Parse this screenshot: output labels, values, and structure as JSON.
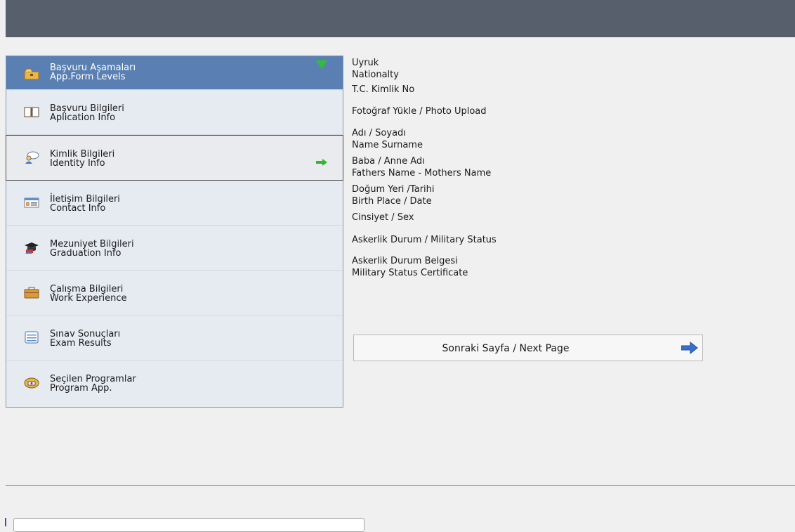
{
  "sidebar": {
    "header": {
      "line1": "Başvuru Aşamaları",
      "line2": "App.Form Levels",
      "icon": "folder-icon"
    },
    "items": [
      {
        "line1": "Başvuru Bilgileri",
        "line2": "Aplication Info",
        "icon": "book-icon"
      },
      {
        "line1": "Kimlik Bilgileri",
        "line2": "Identity Info",
        "icon": "user-icon",
        "active": true
      },
      {
        "line1": "İletişim Bilgileri",
        "line2": "Contact Info",
        "icon": "contact-card-icon"
      },
      {
        "line1": "Mezuniyet Bilgileri",
        "line2": "Graduation Info",
        "icon": "graduation-cap-icon"
      },
      {
        "line1": "Çalışma Bilgileri",
        "line2": "Work Experience",
        "icon": "briefcase-icon"
      },
      {
        "line1": "Sınav Sonuçları",
        "line2": "Exam Results",
        "icon": "document-icon"
      },
      {
        "line1": "Seçilen Programlar",
        "line2": "Program App.",
        "icon": "program-icon"
      }
    ]
  },
  "form": {
    "nationality_tr": "Uyruk",
    "nationality_en": "Nationalty",
    "tc_no": "T.C. Kimlik No",
    "photo": "Fotoğraf Yükle / Photo Upload",
    "name_tr": "Adı / Soyadı",
    "name_en": "Name Surname",
    "parents_tr": "Baba / Anne Adı",
    "parents_en": "Fathers Name - Mothers Name",
    "birth_tr": "Doğum Yeri /Tarihi",
    "birth_en": "Birth Place / Date",
    "sex": "Cinsiyet / Sex",
    "military": "Askerlik Durum / Military Status",
    "military_cert_tr": "Askerlik Durum Belgesi",
    "military_cert_en": "Military Status Certificate"
  },
  "next_button": {
    "label": "Sonraki Sayfa / Next Page"
  }
}
